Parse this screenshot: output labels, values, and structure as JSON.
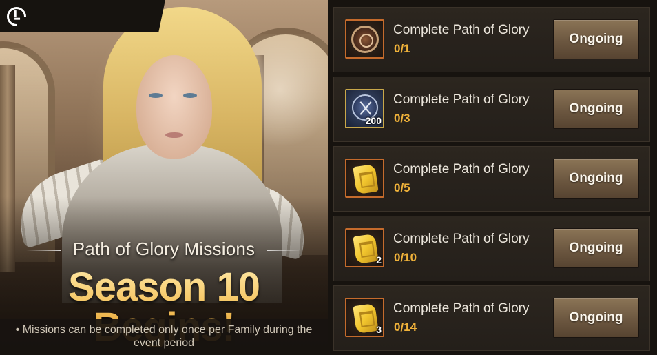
{
  "banner": {
    "subtitle": "Path of Glory Missions",
    "headline": "Season 10 Begins!",
    "note": "• Missions can be completed only once per Family during the event period"
  },
  "colors": {
    "headline_gold": "#f2c158",
    "progress_orange": "#f0b23a",
    "card_bg": "#2c261f",
    "button_bg": "#6c5740"
  },
  "missions": [
    {
      "title": "Complete Path of Glory",
      "progress": "0/1",
      "button_label": "Ongoing",
      "icon": "bronze-medal-icon",
      "quantity": ""
    },
    {
      "title": "Complete Path of Glory",
      "progress": "0/3",
      "button_label": "Ongoing",
      "icon": "blue-emblem-icon",
      "quantity": "200"
    },
    {
      "title": "Complete Path of Glory",
      "progress": "0/5",
      "button_label": "Ongoing",
      "icon": "gold-scroll-icon",
      "quantity": ""
    },
    {
      "title": "Complete Path of Glory",
      "progress": "0/10",
      "button_label": "Ongoing",
      "icon": "gold-scroll-icon",
      "quantity": "2"
    },
    {
      "title": "Complete Path of Glory",
      "progress": "0/14",
      "button_label": "Ongoing",
      "icon": "gold-scroll-icon",
      "quantity": "3"
    }
  ]
}
